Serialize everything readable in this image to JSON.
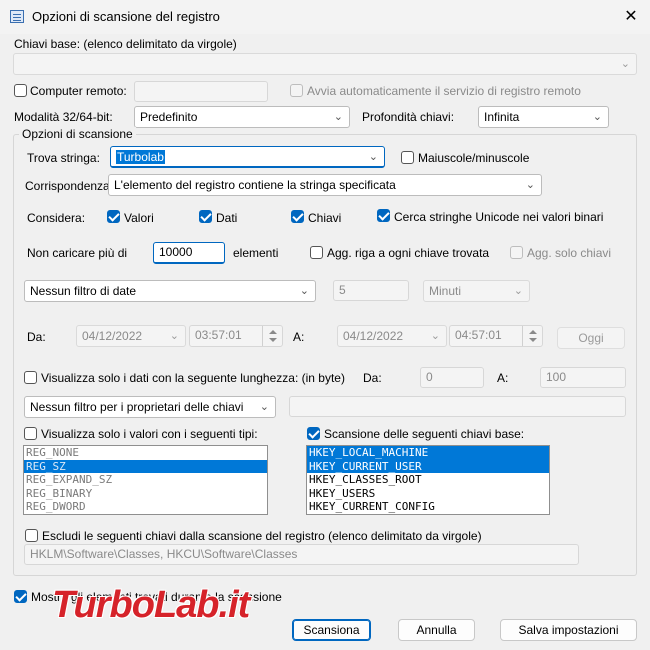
{
  "window": {
    "title": "Opzioni di scansione del registro"
  },
  "base_keys": {
    "label": "Chiavi base:  (elenco delimitato da virgole)",
    "value": ""
  },
  "remote": {
    "label": "Computer remoto:",
    "value": "",
    "auto_start_label": "Avvia automaticamente il servizio di registro remoto"
  },
  "mode": {
    "label": "Modalità 32/64-bit:",
    "value": "Predefinito"
  },
  "depth": {
    "label": "Profondità chiavi:",
    "value": "Infinita"
  },
  "scan_options": {
    "legend": "Opzioni di scansione"
  },
  "find": {
    "label": "Trova stringa:",
    "value": "Turbolab",
    "case_label": "Maiuscole/minuscole"
  },
  "match": {
    "label": "Corrispondenza:",
    "value": "L'elemento del registro contiene la stringa specificata"
  },
  "consider": {
    "label": "Considera:",
    "values_label": "Valori",
    "data_label": "Dati",
    "keys_label": "Chiavi",
    "unicode_label": "Cerca stringhe Unicode nei valori binari"
  },
  "limit": {
    "prefix": "Non caricare più di",
    "value": "10000",
    "suffix": "elementi",
    "add_row_label": "Agg. riga a ogni chiave trovata",
    "keys_only_label": "Agg. solo chiavi"
  },
  "date_filter": {
    "value": "Nessun filtro di date",
    "amount": "5",
    "unit": "Minuti"
  },
  "date_range": {
    "from_label": "Da:",
    "from_date": "04/12/2022",
    "from_time": "03:57:01",
    "to_label": "A:",
    "to_date": "04/12/2022",
    "to_time": "04:57:01",
    "today_label": "Oggi"
  },
  "length_filter": {
    "label": "Visualizza solo i dati con la seguente lunghezza: (in byte)",
    "from_label": "Da:",
    "from_value": "0",
    "to_label": "A:",
    "to_value": "100"
  },
  "owner_filter": {
    "value": "Nessun filtro per i proprietari delle chiavi",
    "text": ""
  },
  "types": {
    "label": "Visualizza solo i valori con i seguenti tipi:",
    "items": [
      "REG_NONE",
      "REG_SZ",
      "REG_EXPAND_SZ",
      "REG_BINARY",
      "REG_DWORD"
    ]
  },
  "base_scan": {
    "label": "Scansione delle seguenti chiavi base:",
    "items": [
      "HKEY_LOCAL_MACHINE",
      "HKEY_CURRENT_USER",
      "HKEY_CLASSES_ROOT",
      "HKEY_USERS",
      "HKEY_CURRENT_CONFIG"
    ]
  },
  "exclude": {
    "label": "Escludi le seguenti chiavi dalla scansione del registro (elenco delimitato da virgole)",
    "value": "HKLM\\Software\\Classes, HKCU\\Software\\Classes"
  },
  "show_found": {
    "label": "Mostra gli elementi trovati durante la scansione"
  },
  "buttons": {
    "scan": "Scansiona",
    "cancel": "Annulla",
    "save": "Salva impostazioni"
  },
  "watermark": {
    "text": "TurboLab.it"
  }
}
